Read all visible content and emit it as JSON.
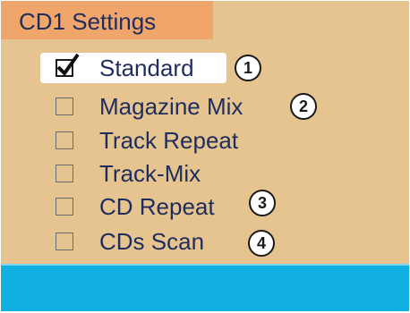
{
  "header": {
    "title": "CD1 Settings"
  },
  "options": [
    {
      "label": "Standard",
      "checked": true,
      "callout": "1"
    },
    {
      "label": "Magazine Mix",
      "checked": false,
      "callout": "2"
    },
    {
      "label": "Track Repeat",
      "checked": false,
      "callout": ""
    },
    {
      "label": "Track-Mix",
      "checked": false,
      "callout": ""
    },
    {
      "label": "CD Repeat",
      "checked": false,
      "callout": "3"
    },
    {
      "label": "CDs Scan",
      "checked": false,
      "callout": "4"
    }
  ],
  "icons": {
    "checkmark": "checkmark-icon"
  },
  "colors": {
    "background": "#e5c48f",
    "title_highlight": "#f0a66a",
    "text": "#1f2d5e",
    "selection": "#ffffff",
    "bottom_bar": "#10b1e2"
  }
}
